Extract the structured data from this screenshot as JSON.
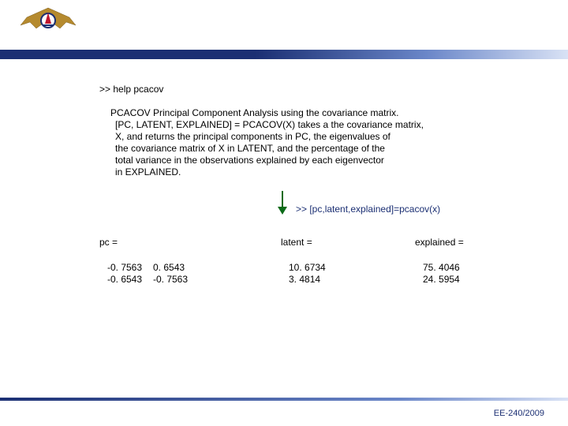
{
  "logo": {
    "name": "ita-wings-logo"
  },
  "help_command": ">> help pcacov",
  "desc_heading": "PCACOV  Principal Component Analysis using the covariance matrix.",
  "desc_lines": [
    "[PC, LATENT, EXPLAINED] = PCACOV(X) takes a the covariance matrix,",
    "X, and returns the principal components in PC, the eigenvalues of",
    "the covariance matrix of X in LATENT, and the percentage of the",
    "total variance in the observations explained by each eigenvector",
    "in EXPLAINED."
  ],
  "call_command": ">> [pc,latent,explained]=pcacov(x)",
  "results": {
    "pc": {
      "label": "pc =",
      "rows": [
        [
          "-0. 7563",
          "0. 6543"
        ],
        [
          "-0. 6543",
          "-0. 7563"
        ]
      ]
    },
    "latent": {
      "label": "latent =",
      "values": [
        "10. 6734",
        "3. 4814"
      ]
    },
    "explained": {
      "label": "explained =",
      "values": [
        "75. 4046",
        "24. 5954"
      ]
    }
  },
  "footer": "EE-240/2009"
}
